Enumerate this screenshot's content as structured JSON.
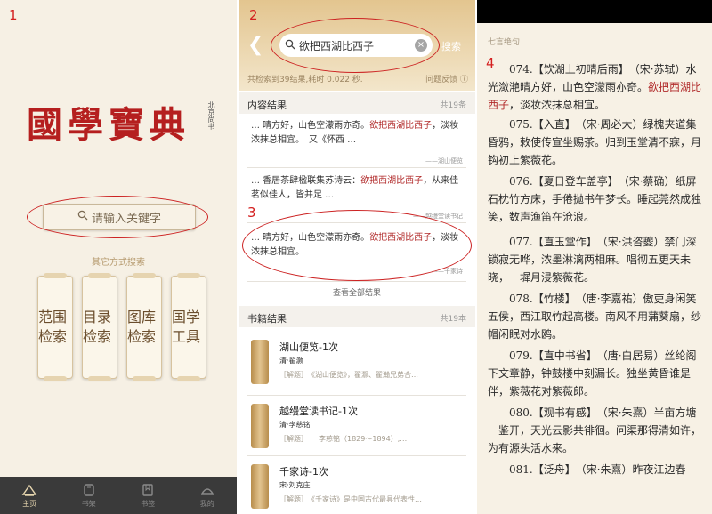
{
  "steps": [
    "1",
    "2",
    "3",
    "4"
  ],
  "home": {
    "logo_text": "國學寶典",
    "seal_text": "北京尚书",
    "search_placeholder": "请输入关键字",
    "other_label": "其它方式搜索",
    "scrolls": [
      {
        "label": "范围检索"
      },
      {
        "label": "目录检索"
      },
      {
        "label": "图库检索"
      },
      {
        "label": "国学工具"
      }
    ],
    "tabs": [
      {
        "label": "主页",
        "icon": "home-icon"
      },
      {
        "label": "书架",
        "icon": "bookshelf-icon"
      },
      {
        "label": "书签",
        "icon": "bookmark-icon"
      },
      {
        "label": "我的",
        "icon": "profile-icon"
      }
    ]
  },
  "results": {
    "back_icon": "back-chevron-icon",
    "query": "欲把西湖比西子",
    "cancel_label": "搜索",
    "count_text": "共检索到39结果,耗时 0.022 秒.",
    "feedback_label": "问题反馈",
    "content_header": "内容结果",
    "content_count": "共19条",
    "items": [
      {
        "pre": "… 晴方好，山色空濛雨亦奇。",
        "hl": "欲把西湖比西子",
        "post": "，淡妆浓抹总相宜。　又《怀西 …",
        "source": "——湖山便览"
      },
      {
        "pre": "… 香居茶肆楹联集苏诗云：",
        "hl": "欲把西湖比西子",
        "post": "，从来佳茗似佳人，皆并足 …",
        "source": "——越缦堂读书记"
      },
      {
        "pre": "… 晴方好，山色空濛雨亦奇。",
        "hl": "欲把西湖比西子",
        "post": "，淡妆浓抹总相宜。",
        "source": "——千家诗"
      }
    ],
    "view_all": "查看全部结果",
    "books_header": "书籍结果",
    "books_count": "共19本",
    "books": [
      {
        "title": "湖山便览-1次",
        "author": "清·翟灏",
        "desc": "［解题］　《湖山便览》，翟灏、翟瀚兄弟合…"
      },
      {
        "title": "越缦堂读书记-1次",
        "author": "清·李慈铭",
        "desc": "［解题］　　李慈铭（1829～1894）,…"
      },
      {
        "title": "千家诗-1次",
        "author": "宋·刘克庄",
        "desc": "［解题］　《千家诗》是中国古代最具代表性…"
      }
    ]
  },
  "reader": {
    "subtitle": "七言绝句",
    "paragraphs": [
      {
        "pre": "074.【饮湖上初晴后雨】　（宋·苏轼）水光潋滟晴方好，山色空濛雨亦奇。",
        "hl": "欲把西湖比西子",
        "post": "，淡妆浓抹总相宜。"
      },
      {
        "pre": "075.【入直】　（宋·周必大）绿槐夹道集昏鸦，敕使传宣坐赐茶。归到玉堂清不寐，月钩初上紫薇花。",
        "hl": "",
        "post": ""
      },
      {
        "pre": "076.【夏日登车盖亭】　（宋·蔡确）纸屏石枕竹方床，手倦抛书午梦长。睡起莞然成独笑，数声渔笛在沧浪。",
        "hl": "",
        "post": ""
      },
      {
        "pre": "077.【直玉堂作】　（宋·洪咨夔）禁门深锁寂无哗，浓墨淋漓两相麻。唱彻五更天未晓，一墀月浸紫薇花。",
        "hl": "",
        "post": ""
      },
      {
        "pre": "078.【竹楼】　（唐·李嘉祐）傲吏身闲笑五侯，西江取竹起高楼。南风不用蒲葵扇，纱帽闲眠对水鸥。",
        "hl": "",
        "post": ""
      },
      {
        "pre": "079.【直中书省】　（唐·白居易）丝纶阁下文章静，钟鼓楼中刻漏长。独坐黄昏谁是伴，紫薇花对紫薇郎。",
        "hl": "",
        "post": ""
      },
      {
        "pre": "080.【观书有感】　（宋·朱熹）半亩方塘一鉴开，天光云影共徘徊。问渠那得清如许，为有源头活水来。",
        "hl": "",
        "post": ""
      },
      {
        "pre": "081.【泛舟】　（宋·朱熹）昨夜江边春",
        "hl": "",
        "post": ""
      }
    ]
  }
}
